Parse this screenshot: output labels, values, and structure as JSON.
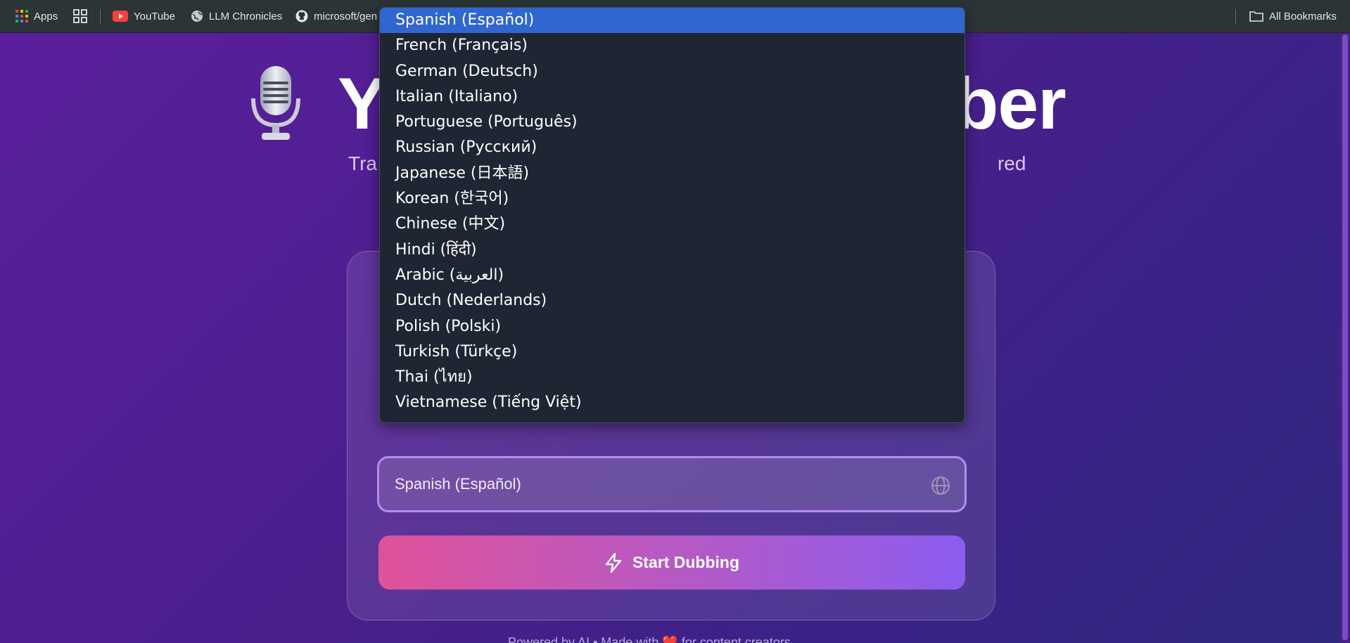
{
  "bookmarks_bar": {
    "apps_label": "Apps",
    "items": [
      {
        "label": "YouTube",
        "icon": "youtube-icon"
      },
      {
        "label": "LLM Chronicles",
        "icon": "globe-icon"
      },
      {
        "label": "microsoft/gen",
        "icon": "github-icon"
      }
    ],
    "all_bookmarks_label": "All Bookmarks"
  },
  "header": {
    "title_left": "Y",
    "title_right": "bber",
    "subtitle_left": "Tra",
    "subtitle_right": "red"
  },
  "language_select": {
    "selected": "Spanish (Español)",
    "options": [
      "Spanish (Español)",
      "French (Français)",
      "German (Deutsch)",
      "Italian (Italiano)",
      "Portuguese (Português)",
      "Russian (Русский)",
      "Japanese (日本語)",
      "Korean (한국어)",
      "Chinese (中文)",
      "Hindi (हिंदी)",
      "Arabic (العربية)",
      "Dutch (Nederlands)",
      "Polish (Polski)",
      "Turkish (Türkçe)",
      "Thai (ไทย)",
      "Vietnamese (Tiếng Việt)"
    ]
  },
  "actions": {
    "start_dubbing_label": "Start Dubbing"
  },
  "footer": {
    "text": "Powered by AI • Made with ❤️ for content creators"
  },
  "colors": {
    "accent_gradient_start": "#e0529a",
    "accent_gradient_end": "#8c5cf0",
    "dropdown_highlight": "#2f66d0"
  }
}
